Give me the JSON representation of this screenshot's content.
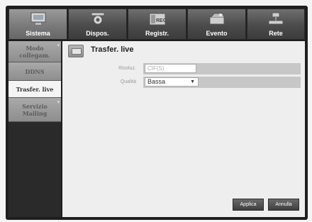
{
  "tabs": [
    {
      "label": "Sistema",
      "icon": "monitor-icon",
      "active": true
    },
    {
      "label": "Dispos.",
      "icon": "camera-icon",
      "active": false
    },
    {
      "label": "Registr.",
      "icon": "rec-icon",
      "active": false
    },
    {
      "label": "Evento",
      "icon": "event-icon",
      "active": false
    },
    {
      "label": "Rete",
      "icon": "network-icon",
      "active": false
    }
  ],
  "sidebar": {
    "items": [
      {
        "label": "Modo collegam.",
        "active": false
      },
      {
        "label": "DDNS",
        "active": false
      },
      {
        "label": "Trasfer. live",
        "active": true
      },
      {
        "label": "Servizio Mailing",
        "active": false
      }
    ]
  },
  "panel": {
    "title": "Trasfer. live",
    "rows": [
      {
        "label": "Risoluz.",
        "value": "CIF(S)"
      },
      {
        "label": "Qualità",
        "value": "Bassa"
      }
    ]
  },
  "buttons": {
    "apply": "Applica",
    "cancel": "Annulla"
  }
}
